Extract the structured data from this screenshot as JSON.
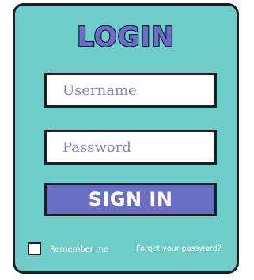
{
  "login_form": {
    "title": "LOGIN",
    "username": {
      "placeholder": "Username",
      "value": ""
    },
    "password": {
      "placeholder": "Password",
      "value": ""
    },
    "submit_label": "SIGN IN",
    "remember_label": "Remember me",
    "remember_checked": false,
    "forgot_link": "Forget your password?"
  },
  "colors": {
    "card_background": "#6ecdc9",
    "accent": "#6b6fc4",
    "border": "#1e1e28",
    "placeholder_text": "#7f83cc"
  }
}
